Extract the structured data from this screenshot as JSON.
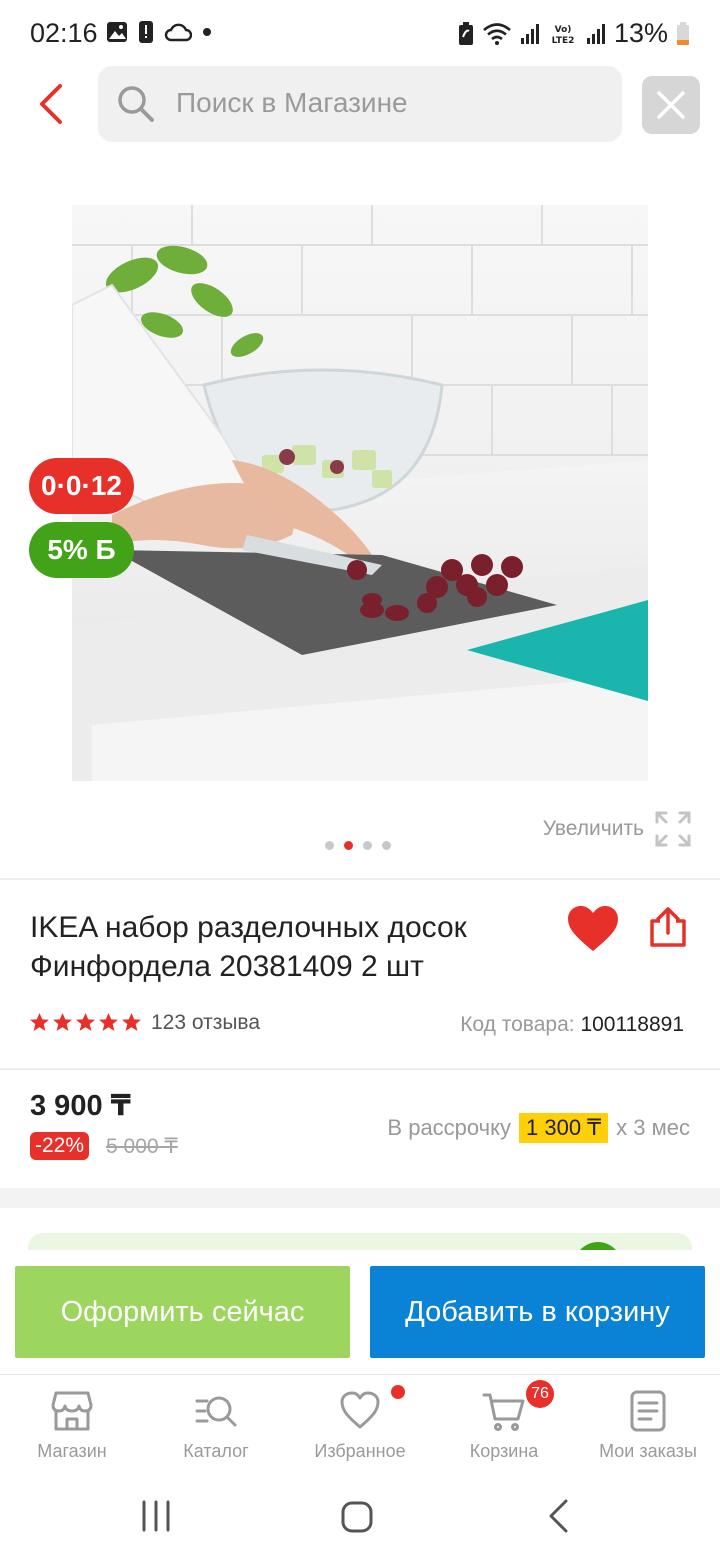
{
  "status_bar": {
    "time": "02:16",
    "battery": "13%"
  },
  "search": {
    "placeholder": "Поиск в Магазине"
  },
  "badges": {
    "installment": "0·0·12",
    "bonus": "5% Б"
  },
  "gallery": {
    "zoom_label": "Увеличить",
    "slides": 4,
    "active_slide": 2
  },
  "product": {
    "title": "IKEA набор разделочных досок Финфордела 20381409 2 шт",
    "rating": 5,
    "reviews": "123 отзыва",
    "sku_label": "Код товара:",
    "sku": "100118891"
  },
  "price": {
    "current": "3 900 ₸",
    "discount": "-22%",
    "old": "5 000 ₸",
    "installment_prefix": "В рассрочку",
    "installment_amount": "1 300 ₸",
    "installment_suffix": "х 3 мес"
  },
  "actions": {
    "checkout": "Оформить сейчас",
    "add_to_cart": "Добавить в корзину"
  },
  "nav": {
    "items": [
      {
        "label": "Магазин",
        "icon": "store-icon"
      },
      {
        "label": "Каталог",
        "icon": "catalog-search-icon"
      },
      {
        "label": "Избранное",
        "icon": "heart-icon"
      },
      {
        "label": "Корзина",
        "icon": "cart-icon",
        "badge": "76"
      },
      {
        "label": "Мои заказы",
        "icon": "orders-icon"
      }
    ]
  },
  "colors": {
    "accent_red": "#e8302a",
    "bonus_green": "#43a318",
    "checkout_green": "#9dd65f",
    "cart_blue": "#0a82d6",
    "installment_yellow": "#ffcf0a"
  }
}
